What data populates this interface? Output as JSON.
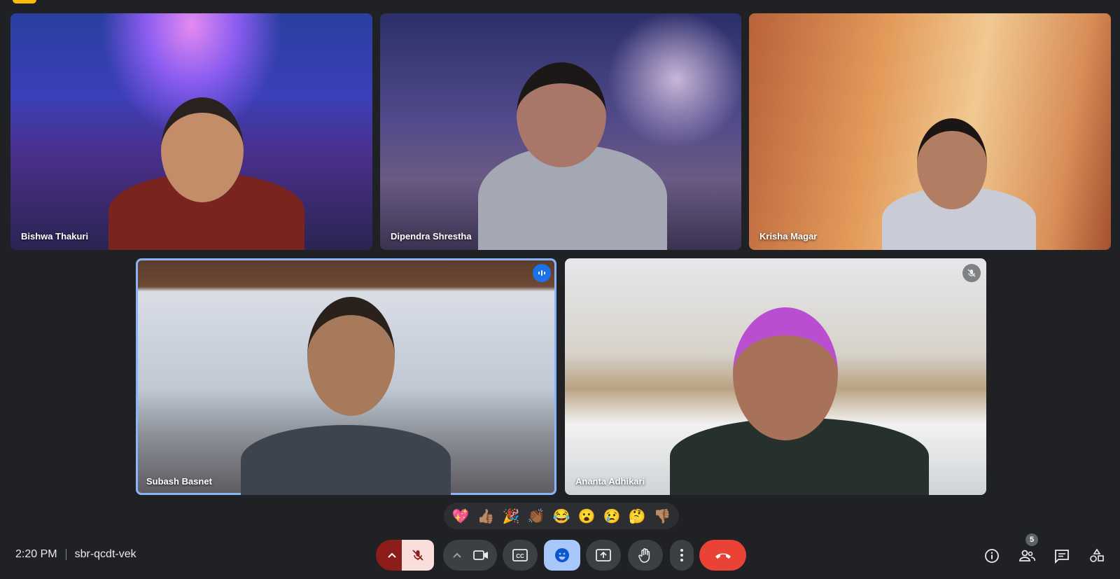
{
  "participants": [
    {
      "name": "Bishwa Thakuri"
    },
    {
      "name": "Dipendra Shrestha"
    },
    {
      "name": "Krisha Magar"
    },
    {
      "name": "Subash Basnet"
    },
    {
      "name": "Ananta Adhikari"
    }
  ],
  "reactions": [
    "💖",
    "👍🏽",
    "🎉",
    "👏🏾",
    "😂",
    "😮",
    "😢",
    "🤔",
    "👎🏽"
  ],
  "footer": {
    "time": "2:20 PM",
    "meeting_code": "sbr-qcdt-vek"
  },
  "people_count": "5",
  "colors": {
    "background": "#202124",
    "active_speaker": "#8ab4f8",
    "end_call": "#ea4335",
    "mic_off": "#f9dedc",
    "reaction_active": "#a8c7fa"
  },
  "icons": [
    "mic-off-icon",
    "camera-icon",
    "captions-icon",
    "emoji-icon",
    "present-icon",
    "raise-hand-icon",
    "more-options-icon",
    "end-call-icon",
    "info-icon",
    "people-icon",
    "chat-icon",
    "activities-icon"
  ]
}
